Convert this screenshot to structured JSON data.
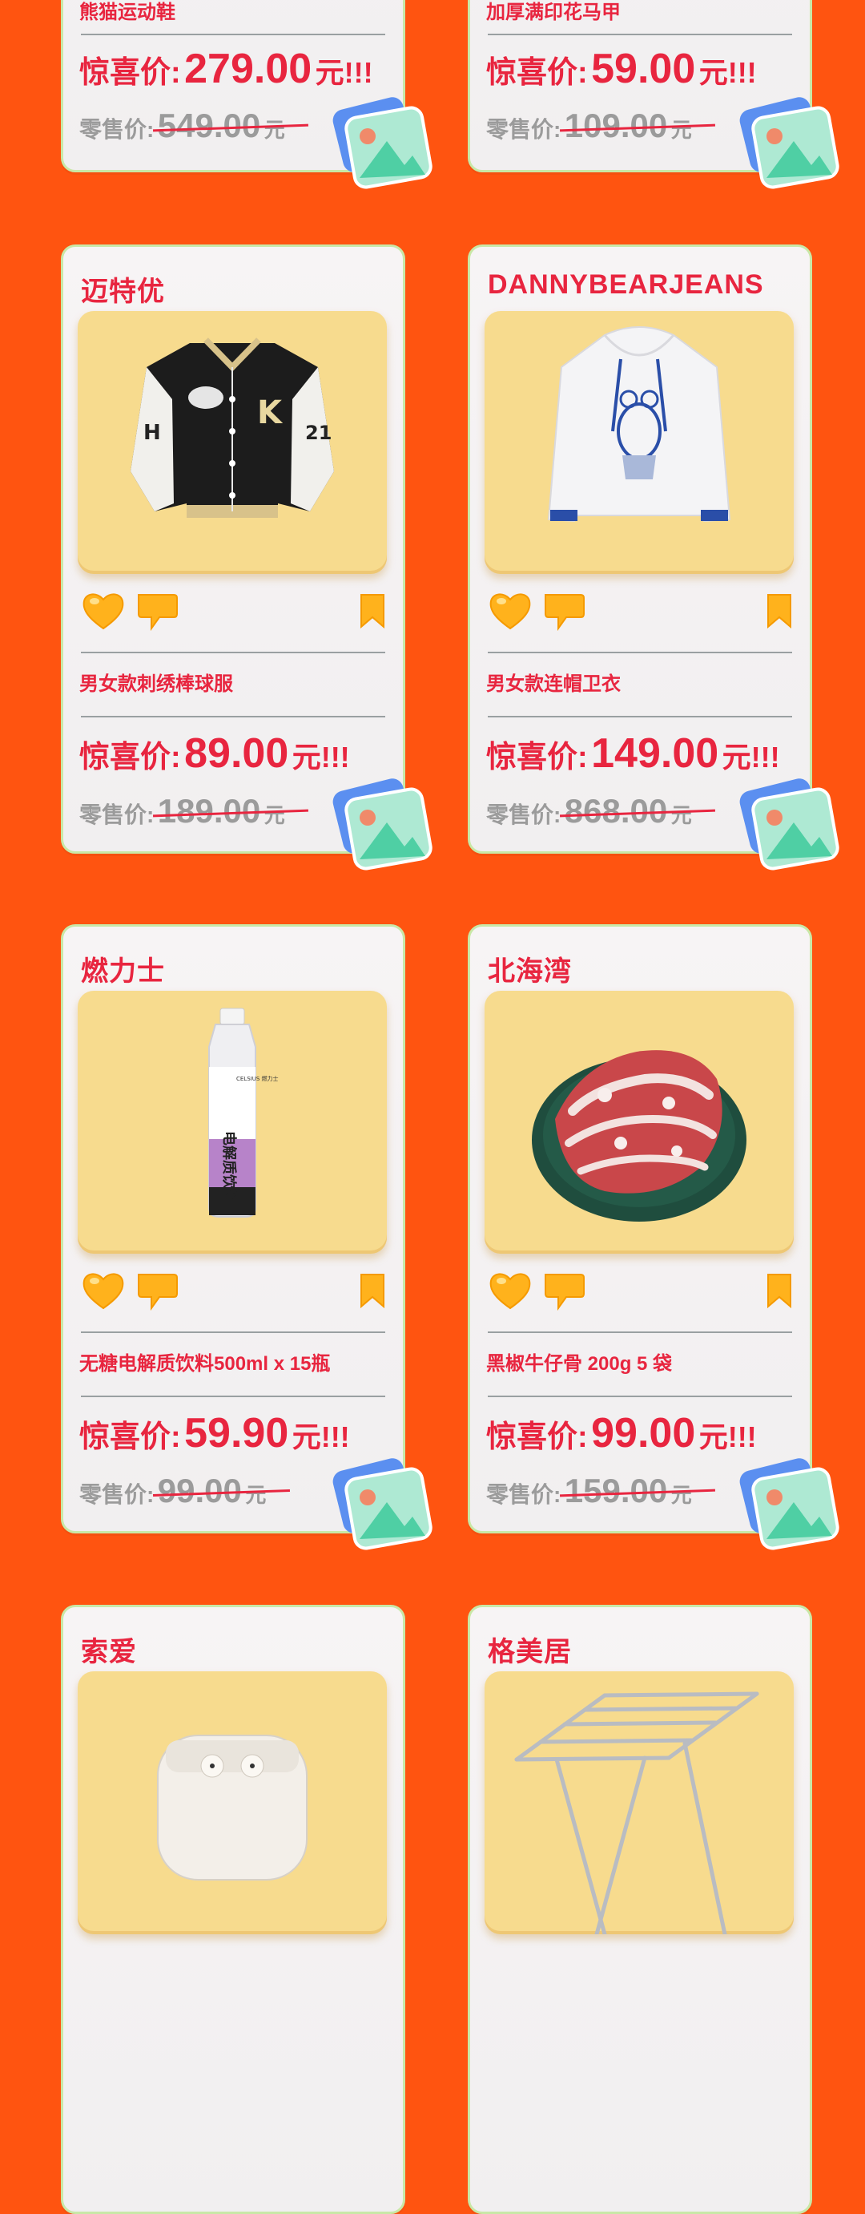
{
  "top_cards": [
    {
      "name": "熊猫运动鞋",
      "price_label": "惊喜价:",
      "price": "279.00",
      "price_unit": "元!!!",
      "retail_label": "零售价:",
      "retail": "549.00",
      "retail_unit": "元"
    },
    {
      "name": "加厚满印花马甲",
      "price_label": "惊喜价:",
      "price": "59.00",
      "price_unit": "元!!!",
      "retail_label": "零售价:",
      "retail": "109.00",
      "retail_unit": "元"
    }
  ],
  "cards": [
    {
      "brand": "迈特优",
      "name": "男女款刺绣棒球服",
      "price_label": "惊喜价:",
      "price": "89.00",
      "price_unit": "元!!!",
      "retail_label": "零售价:",
      "retail": "189.00",
      "retail_unit": "元"
    },
    {
      "brand": "DANNYBEARJEANS",
      "name": "男女款连帽卫衣",
      "price_label": "惊喜价:",
      "price": "149.00",
      "price_unit": "元!!!",
      "retail_label": "零售价:",
      "retail": "868.00",
      "retail_unit": "元"
    },
    {
      "brand": "燃力士",
      "name": "无糖电解质饮料500ml x 15瓶",
      "price_label": "惊喜价:",
      "price": "59.90",
      "price_unit": "元!!!",
      "retail_label": "零售价:",
      "retail": "99.00",
      "retail_unit": "元"
    },
    {
      "brand": "北海湾",
      "name": "黑椒牛仔骨 200g 5 袋",
      "price_label": "惊喜价:",
      "price": "99.00",
      "price_unit": "元!!!",
      "retail_label": "零售价:",
      "retail": "159.00",
      "retail_unit": "元"
    },
    {
      "brand": "索爱"
    },
    {
      "brand": "格美居"
    }
  ],
  "bottle_label": {
    "title": "电解质饮料",
    "brand": "CELSIUS 燃力士"
  },
  "icons": [
    "heart-icon",
    "thumbs-down-icon",
    "bookmark-icon",
    "image-icon"
  ],
  "colors": {
    "background": "#FF5410",
    "accent": "#E8253F",
    "image_bg": "#F7DB8E",
    "muted": "#9B9B9B"
  }
}
